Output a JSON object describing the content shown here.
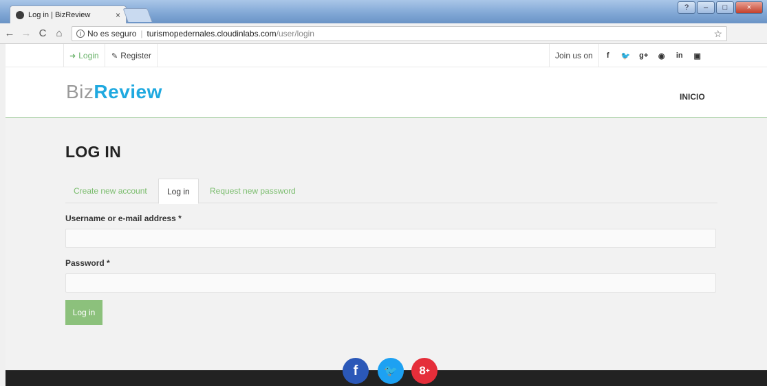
{
  "browser": {
    "tab_title": "Log in | BizReview",
    "tab_close": "×",
    "nav": {
      "back": "←",
      "forward": "→",
      "reload": "C",
      "home": "⌂"
    },
    "url_info": "i",
    "url_security": "No es seguro",
    "url_separator": "|",
    "url_host": "turismopedernales.cloudinlabs.com",
    "url_path": "/user/login",
    "bookmark_star": "☆",
    "window_buttons": {
      "help": "?",
      "minimize": "–",
      "maximize": "□"
    }
  },
  "topbar": {
    "login_label": "Login",
    "register_label": "Register",
    "join_us": "Join us on",
    "social": [
      "f",
      "t",
      "g+",
      "p",
      "in",
      "yt"
    ]
  },
  "header": {
    "logo_part1": "Biz",
    "logo_part2": "Review",
    "nav_inicio": "INICIO"
  },
  "main": {
    "title": "LOG IN",
    "tabs": [
      {
        "label": "Create new account"
      },
      {
        "label": "Log in"
      },
      {
        "label": "Request new password"
      }
    ],
    "username_label": "Username or e-mail address *",
    "username_value": "",
    "password_label": "Password *",
    "password_value": "",
    "submit_label": "Log in"
  },
  "footer": {
    "social": [
      "f",
      "t",
      "g+"
    ]
  },
  "colors": {
    "accent_green": "#8cc17c",
    "logo_blue": "#1fa9e0",
    "facebook": "#2b58b8",
    "twitter": "#1da1f2",
    "google": "#e52e3a"
  }
}
